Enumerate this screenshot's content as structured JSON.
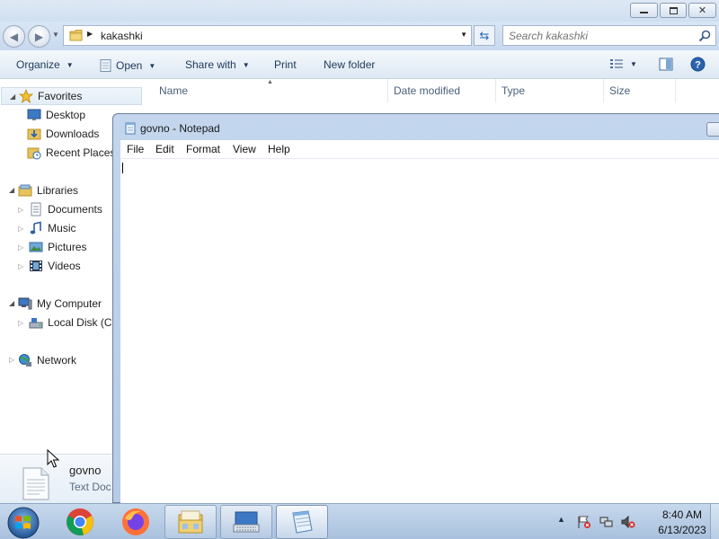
{
  "explorer": {
    "address_path": "kakashki",
    "search_placeholder": "Search kakashki",
    "toolbar": {
      "organize": "Organize",
      "open": "Open",
      "share_with": "Share with",
      "print": "Print",
      "new_folder": "New folder"
    },
    "nav_pane": {
      "favorites": {
        "label": "Favorites",
        "items": [
          "Desktop",
          "Downloads",
          "Recent Places"
        ]
      },
      "libraries": {
        "label": "Libraries",
        "items": [
          "Documents",
          "Music",
          "Pictures",
          "Videos"
        ]
      },
      "computer": {
        "label": "My Computer",
        "items": [
          "Local Disk (C:)"
        ]
      },
      "network": {
        "label": "Network"
      }
    },
    "columns": [
      "Name",
      "Date modified",
      "Type",
      "Size"
    ],
    "details_pane": {
      "file_name": "govno",
      "file_type": "Text Doc"
    }
  },
  "notepad": {
    "title": "govno - Notepad",
    "menu": [
      "File",
      "Edit",
      "Format",
      "View",
      "Help"
    ],
    "content": ""
  },
  "taskbar": {
    "apps": [
      "start-orb-icon",
      "chrome-icon",
      "firefox-icon",
      "explorer-icon",
      "keyboard-icon",
      "notepad-icon"
    ],
    "clock_time": "8:40 AM",
    "clock_date": "6/13/2023"
  },
  "colors": {
    "accent": "#1e395b",
    "taskbar": "#b9cde5",
    "window_frame": "#bcd0e9"
  }
}
